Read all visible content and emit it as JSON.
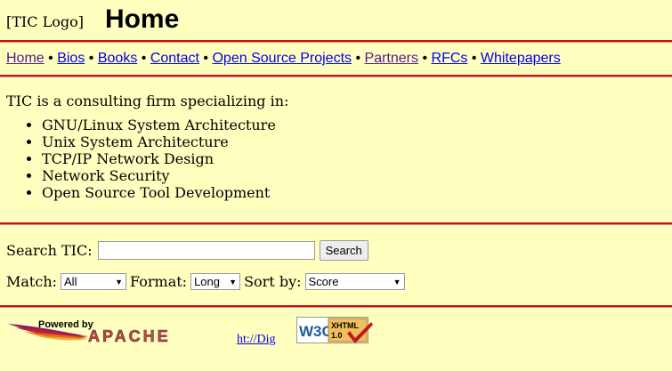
{
  "header": {
    "logo_alt": "[TIC Logo]",
    "title": "Home"
  },
  "nav": {
    "items": [
      {
        "label": "Home",
        "visited": true
      },
      {
        "label": "Bios",
        "visited": false
      },
      {
        "label": "Books",
        "visited": false
      },
      {
        "label": "Contact",
        "visited": false
      },
      {
        "label": "Open Source Projects",
        "visited": false
      },
      {
        "label": "Partners",
        "visited": true
      },
      {
        "label": "RFCs",
        "visited": false
      },
      {
        "label": "Whitepapers",
        "visited": false
      }
    ],
    "separator": "•"
  },
  "content": {
    "intro": "TIC is a consulting firm specializing in:",
    "services": [
      "GNU/Linux System Architecture",
      "Unix System Architecture",
      "TCP/IP Network Design",
      "Network Security",
      "Open Source Tool Development"
    ]
  },
  "search": {
    "label": "Search TIC:",
    "value": "",
    "button": "Search",
    "match_label": "Match:",
    "match_value": "All",
    "format_label": "Format:",
    "format_value": "Long",
    "sort_label": "Sort by:",
    "sort_value": "Score"
  },
  "footer": {
    "powered_by": "Powered by",
    "apache": "APACHE",
    "link_text": "ht://Dig",
    "w3c": "W3C",
    "xhtml": "XHTML",
    "xhtml_version": "1.0"
  },
  "colors": {
    "background": "#ffffc0",
    "rule": "#c01818",
    "link": "#0000ee",
    "visited": "#551a8b"
  }
}
